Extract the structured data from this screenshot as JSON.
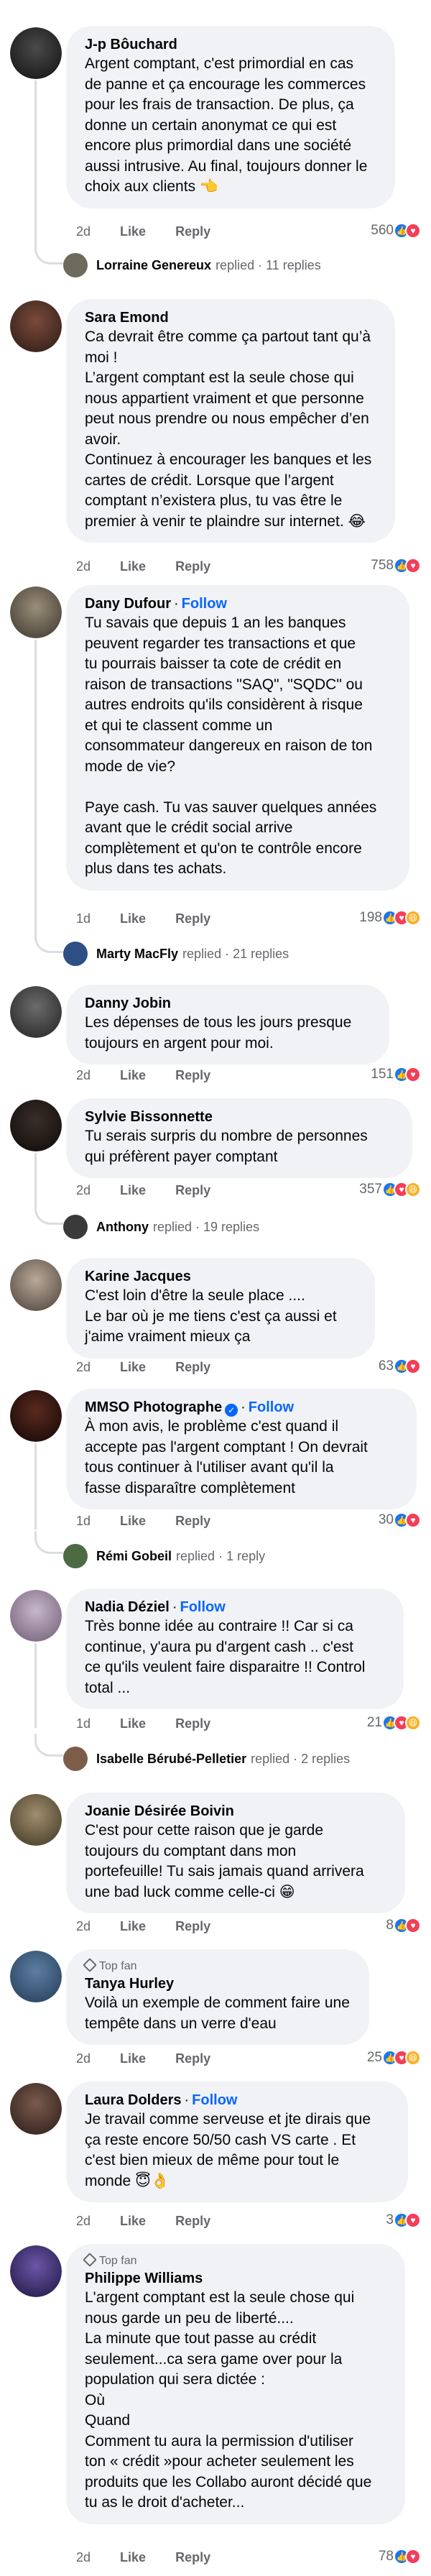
{
  "comments": [
    {
      "author": "J-p Bôuchard",
      "follow": "",
      "top_fan": "",
      "text": "Argent comptant, c'est primordial en cas\nde panne et ça encourage les commerces\npour les frais de transaction.  De plus, ça\ndonne un certain anonymat ce qui est\nencore plus primordial dans une société\naussi intrusive. Au final, toujours donner le\nchoix aux clients 👈",
      "time": "2d",
      "like": "Like",
      "reply": "Reply",
      "reactions": "560",
      "reply_summary": {
        "name": "Lorraine Genereux",
        "meta": "replied · 11 replies"
      }
    },
    {
      "author": "Sara Emond",
      "follow": "",
      "top_fan": "",
      "text": "Ca devrait être comme ça partout tant qu’à\nmoi !\nL’argent comptant est la seule chose qui\nnous appartient vraiment et que personne\npeut nous prendre ou nous empêcher d’en\navoir.\nContinuez à encourager les banques et les\ncartes de crédit. Lorsque que l’argent\ncomptant n’existera plus, tu vas être le\npremier à venir te plaindre sur internet. 😂",
      "time": "2d",
      "like": "Like",
      "reply": "Reply",
      "reactions": "758"
    },
    {
      "author": "Dany Dufour",
      "follow": "Follow",
      "top_fan": "",
      "text": "Tu savais que depuis 1 an les banques\npeuvent regarder tes transactions et que\ntu pourrais baisser ta cote de crédit en\nraison de transactions \"SAQ\", \"SQDC\" ou\nautres endroits qu'ils considèrent à risque\net qui te classent comme un\nconsommateur dangereux en raison de ton\nmode de vie?\n\nPaye cash. Tu vas sauver quelques années\navant que le crédit social arrive\ncomplètement et qu'on te contrôle encore\nplus dans tes achats.",
      "time": "1d",
      "like": "Like",
      "reply": "Reply",
      "reactions": "198",
      "reply_summary": {
        "name": "Marty MacFly",
        "meta": "replied · 21 replies"
      }
    },
    {
      "author": "Danny Jobin",
      "follow": "",
      "top_fan": "",
      "text": "Les dépenses de tous les jours presque\ntoujours en argent pour moi.",
      "time": "2d",
      "like": "Like",
      "reply": "Reply",
      "reactions": "151"
    },
    {
      "author": "Sylvie Bissonnette",
      "follow": "",
      "top_fan": "",
      "text": "Tu serais surpris du nombre de personnes\nqui préfèrent payer comptant",
      "time": "2d",
      "like": "Like",
      "reply": "Reply",
      "reactions": "357",
      "reply_summary": {
        "name": "Anthony",
        "meta": "replied · 19 replies"
      }
    },
    {
      "author": "Karine Jacques",
      "follow": "",
      "top_fan": "",
      "text": "C'est loin d'être la seule place ....\nLe bar où je me tiens c'est ça aussi et\nj'aime vraiment mieux ça",
      "time": "2d",
      "like": "Like",
      "reply": "Reply",
      "reactions": "63"
    },
    {
      "author": "MMSO Photographe",
      "follow": "Follow",
      "top_fan": "",
      "text": "À mon avis, le problème c'est quand il\naccepte pas l'argent comptant !  On devrait\ntous continuer à l'utiliser avant qu'il la\nfasse disparaître complètement",
      "time": "1d",
      "like": "Like",
      "reply": "Reply",
      "reactions": "30",
      "reply_summary": {
        "name": "Rémi Gobeil",
        "meta": "replied · 1 reply"
      }
    },
    {
      "author": "Nadia Déziel",
      "follow": "Follow",
      "top_fan": "",
      "text": "Très bonne idée au contraire !! Car si ca\ncontinue, y'aura pu d'argent cash .. c'est\nce qu'ils veulent faire disparaitre !! Control\ntotal ...",
      "time": "1d",
      "like": "Like",
      "reply": "Reply",
      "reactions": "21",
      "reply_summary": {
        "name": "Isabelle Bérubé-Pelletier",
        "meta": "replied · 2 replies"
      }
    },
    {
      "author": "Joanie Désirée Boivin",
      "follow": "",
      "top_fan": "",
      "text": "C'est pour cette raison que je garde\ntoujours du comptant dans mon\nportefeuille! Tu sais jamais quand arrivera\nune bad luck comme celle-ci 😁",
      "time": "2d",
      "like": "Like",
      "reply": "Reply",
      "reactions": "8"
    },
    {
      "author": "Tanya Hurley",
      "follow": "",
      "top_fan": "Top fan",
      "text": "Voilà un exemple de comment faire une\ntempête dans un verre d'eau",
      "time": "2d",
      "like": "Like",
      "reply": "Reply",
      "reactions": "25"
    },
    {
      "author": "Laura Dolders",
      "follow": "Follow",
      "top_fan": "",
      "text": "Je travail comme serveuse et jte dirais que\nça reste encore 50/50 cash VS carte . Et\nc'est bien mieux de même pour tout le\nmonde 😇👌",
      "time": "2d",
      "like": "Like",
      "reply": "Reply",
      "reactions": "3"
    },
    {
      "author": "Philippe Williams",
      "follow": "",
      "top_fan": "Top fan",
      "text": "L'argent comptant est la seule chose qui\nnous garde un peu de liberté....\nLa minute que tout passe au crédit\nseulement...ca sera game over pour la\npopulation qui sera dictée :\nOù\nQuand\nComment tu aura la permission d'utiliser\nton « crédit »pour acheter seulement les\nproduits que les Collabo auront décidé que\ntu as le droit d'acheter...",
      "time": "2d",
      "like": "Like",
      "reply": "Reply",
      "reactions": "78"
    }
  ],
  "colors": {
    "bubble": "#f0f2f5",
    "follow": "#0866ff",
    "meta": "#65676b",
    "like": "#1877f2",
    "love": "#f33e58",
    "haha": "#f7b125"
  }
}
